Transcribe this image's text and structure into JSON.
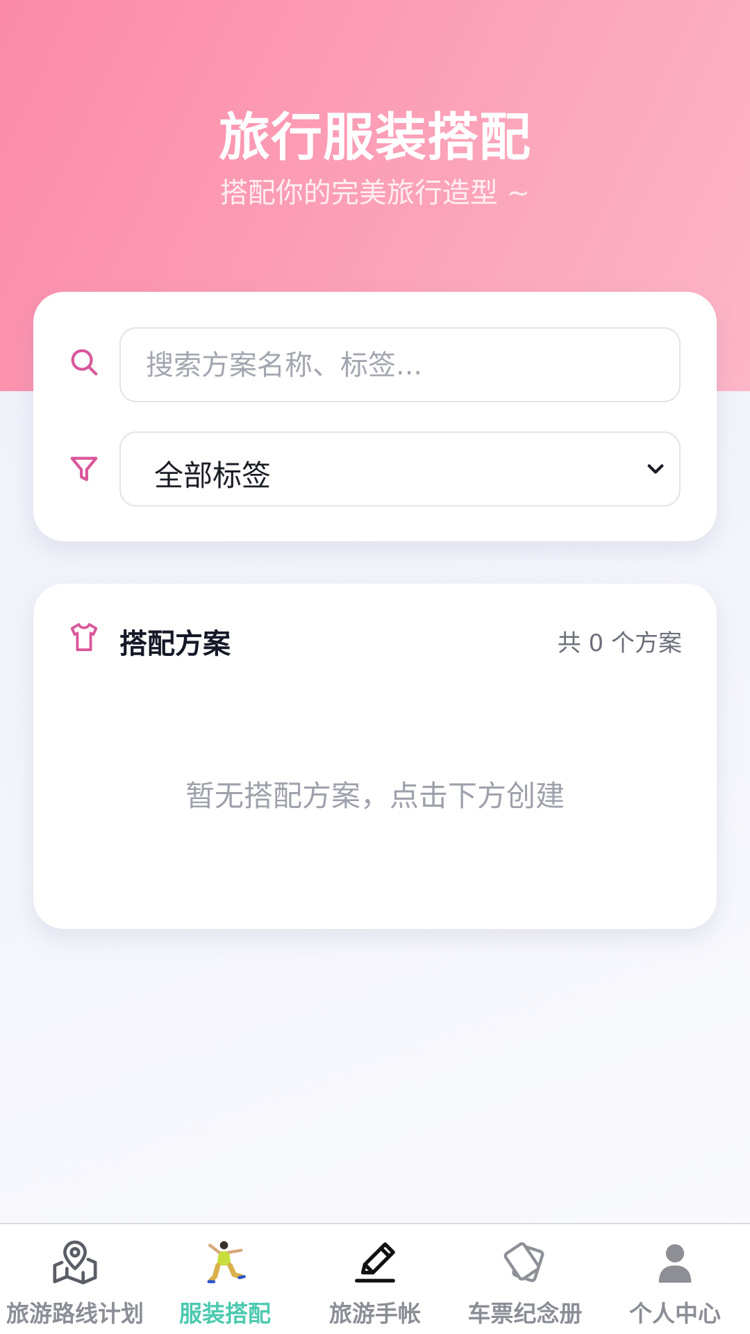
{
  "header": {
    "title": "旅行服装搭配",
    "subtitle": "搭配你的完美旅行造型 ~"
  },
  "filters": {
    "search_placeholder": "搜索方案名称、标签...",
    "search_value": "",
    "tag_select_value": "全部标签"
  },
  "outfits": {
    "title": "搭配方案",
    "count_text": "共 0 个方案",
    "empty_text": "暂无搭配方案，点击下方创建"
  },
  "tabbar": {
    "items": [
      {
        "label": "旅游路线计划",
        "icon": "map-pin-icon",
        "active": false
      },
      {
        "label": "服装搭配",
        "icon": "dancer-figure-icon",
        "active": true
      },
      {
        "label": "旅游手帐",
        "icon": "pencil-icon",
        "active": false
      },
      {
        "label": "车票纪念册",
        "icon": "ticket-cards-icon",
        "active": false
      },
      {
        "label": "个人中心",
        "icon": "user-icon",
        "active": false
      }
    ]
  },
  "colors": {
    "hero_pink": "#fb8aa9",
    "icon_pink": "#d9579a",
    "active_tab": "#4cc9b0",
    "inactive_tab": "#8b8e96"
  }
}
